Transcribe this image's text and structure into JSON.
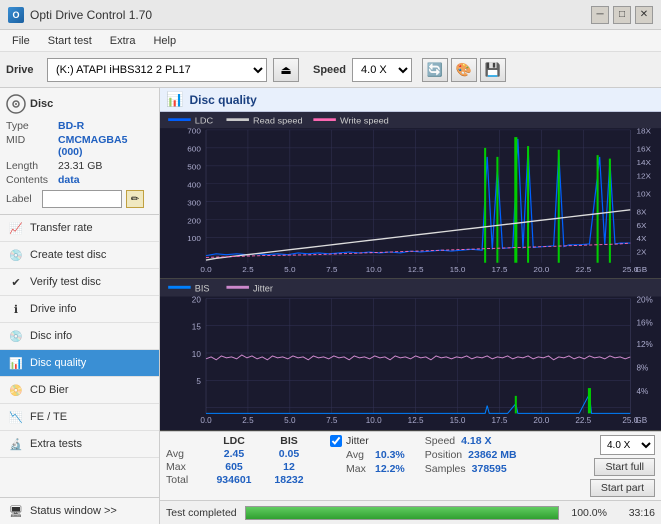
{
  "titlebar": {
    "title": "Opti Drive Control 1.70",
    "minimize": "─",
    "maximize": "□",
    "close": "✕"
  },
  "menu": {
    "items": [
      "File",
      "Start test",
      "Extra",
      "Help"
    ]
  },
  "drive_toolbar": {
    "drive_label": "Drive",
    "drive_value": "(K:)  ATAPI iHBS312  2 PL17",
    "speed_label": "Speed",
    "speed_value": "4.0 X",
    "eject_icon": "⏏",
    "toolbar_icons": [
      "🔄",
      "🎨",
      "💾"
    ]
  },
  "disc_panel": {
    "title": "Disc",
    "type_label": "Type",
    "type_val": "BD-R",
    "mid_label": "MID",
    "mid_val": "CMCMAGBA5 (000)",
    "length_label": "Length",
    "length_val": "23.31 GB",
    "contents_label": "Contents",
    "contents_val": "data",
    "label_label": "Label",
    "label_val": ""
  },
  "nav": {
    "items": [
      {
        "id": "transfer-rate",
        "label": "Transfer rate",
        "icon": "📈"
      },
      {
        "id": "create-test-disc",
        "label": "Create test disc",
        "icon": "💿"
      },
      {
        "id": "verify-test-disc",
        "label": "Verify test disc",
        "icon": "✔"
      },
      {
        "id": "drive-info",
        "label": "Drive info",
        "icon": "ℹ"
      },
      {
        "id": "disc-info",
        "label": "Disc info",
        "icon": "💿"
      },
      {
        "id": "disc-quality",
        "label": "Disc quality",
        "icon": "📊",
        "active": true
      },
      {
        "id": "cd-bier",
        "label": "CD Bier",
        "icon": "📀"
      },
      {
        "id": "fe-te",
        "label": "FE / TE",
        "icon": "📉"
      },
      {
        "id": "extra-tests",
        "label": "Extra tests",
        "icon": "🔬"
      }
    ],
    "status_window": "Status window >>"
  },
  "disc_quality": {
    "title": "Disc quality",
    "legend": {
      "ldc": "LDC",
      "read_speed": "Read speed",
      "write_speed": "Write speed",
      "bis": "BIS",
      "jitter": "Jitter"
    },
    "chart1": {
      "y_max": 700,
      "y_labels": [
        "700",
        "600",
        "500",
        "400",
        "300",
        "200",
        "100"
      ],
      "y_right_labels": [
        "18X",
        "16X",
        "14X",
        "12X",
        "10X",
        "8X",
        "6X",
        "4X",
        "2X"
      ],
      "x_labels": [
        "0.0",
        "2.5",
        "5.0",
        "7.5",
        "10.0",
        "12.5",
        "15.0",
        "17.5",
        "20.0",
        "22.5",
        "25.0"
      ]
    },
    "chart2": {
      "y_max": 20,
      "y_labels": [
        "20",
        "15",
        "10",
        "5"
      ],
      "y_right_labels": [
        "20%",
        "16%",
        "12%",
        "8%",
        "4%"
      ],
      "x_labels": [
        "0.0",
        "2.5",
        "5.0",
        "7.5",
        "10.0",
        "12.5",
        "15.0",
        "17.5",
        "20.0",
        "22.5",
        "25.0"
      ]
    }
  },
  "stats": {
    "headers": [
      "",
      "LDC",
      "BIS"
    ],
    "avg_label": "Avg",
    "avg_ldc": "2.45",
    "avg_bis": "0.05",
    "max_label": "Max",
    "max_ldc": "605",
    "max_bis": "12",
    "total_label": "Total",
    "total_ldc": "934601",
    "total_bis": "18232",
    "jitter_label": "Jitter",
    "jitter_avg": "10.3%",
    "jitter_max": "12.2%",
    "speed_label": "Speed",
    "speed_val": "4.18 X",
    "position_label": "Position",
    "position_val": "23862 MB",
    "samples_label": "Samples",
    "samples_val": "378595",
    "speed_select": "4.0 X",
    "start_full": "Start full",
    "start_part": "Start part"
  },
  "progress": {
    "status_text": "Test completed",
    "percent": "100.0%",
    "time": "33:16"
  }
}
